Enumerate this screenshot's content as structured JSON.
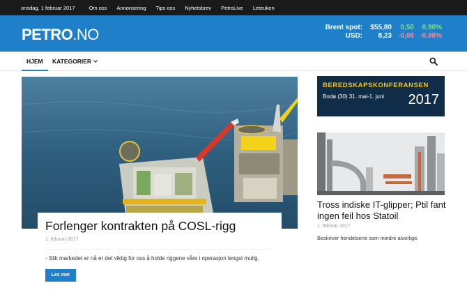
{
  "topbar": {
    "date": "onsdag, 1 februar 2017",
    "links": [
      "Om oss",
      "Annonsering",
      "Tips oss",
      "Nyhetsbrev",
      "PetroLive",
      "Leteuken"
    ]
  },
  "header": {
    "logo_bold": "PETRO",
    "logo_light": ".NO",
    "ticker": [
      {
        "label": "Brent spot:",
        "value": "$55,80",
        "change": "0,50",
        "percent": "0,90%",
        "direction": "up"
      },
      {
        "label": "USD:",
        "value": "8,23",
        "change": "-0,08",
        "percent": "-0,98%",
        "direction": "down"
      }
    ]
  },
  "nav": {
    "home": "HJEM",
    "categories": "KATEGORIER"
  },
  "main_article": {
    "title": "Forlenger kontrakten på COSL-rigg",
    "date": "1. februar 2017",
    "excerpt": "- Slik markedet er nå er det viktig for oss å holde riggene våre i operasjon lengst mulig.",
    "read_more": "Les mer"
  },
  "banner": {
    "line1": "BEREDSKAPSKONFERANSEN",
    "line2": "Bodø (30) 31. mai-1. juni",
    "year": "2017"
  },
  "side_article": {
    "title": "Tross indiske IT-glipper; Ptil fant ingen feil hos Statoil",
    "date": "1. februar 2017",
    "excerpt": "Beskriver hendelsene som mindre alvorlige."
  },
  "colors": {
    "brand_blue": "#1f7fc9",
    "topbar": "#1a1a1a",
    "positive": "#7ee07a",
    "negative": "#ff8a8a"
  }
}
